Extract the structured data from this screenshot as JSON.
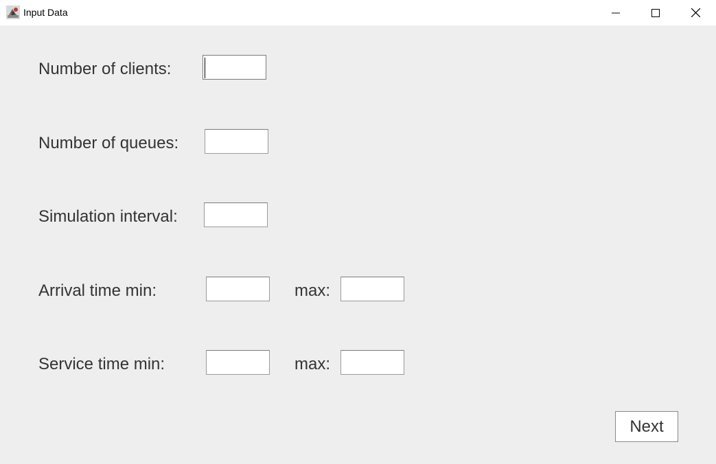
{
  "window": {
    "title": "Input Data",
    "controls": {
      "minimize": "minimize-icon",
      "maximize": "maximize-icon",
      "close": "close-icon"
    }
  },
  "form": {
    "clients_label": "Number of clients:",
    "clients_value": "",
    "queues_label": "Number of queues:",
    "queues_value": "",
    "interval_label": "Simulation interval:",
    "interval_value": "",
    "arrival_min_label": "Arrival time min:",
    "arrival_min_value": "",
    "arrival_max_label": "max:",
    "arrival_max_value": "",
    "service_min_label": "Service time min:",
    "service_min_value": "",
    "service_max_label": "max:",
    "service_max_value": ""
  },
  "actions": {
    "next_label": "Next"
  }
}
